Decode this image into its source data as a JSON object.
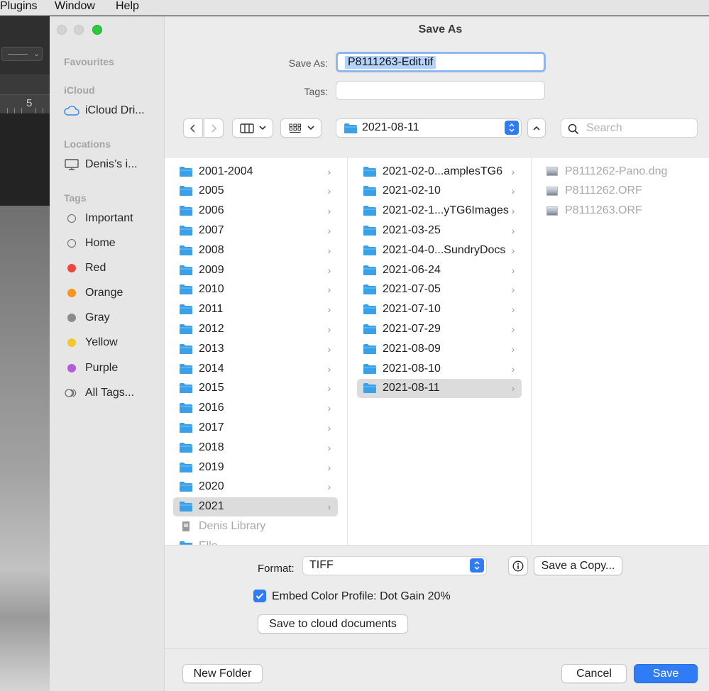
{
  "menubar": {
    "items": [
      "Plugins",
      "Window",
      "Help"
    ]
  },
  "background": {
    "ruler_number": "5"
  },
  "dialog": {
    "title": "Save As",
    "save_as_label": "Save As:",
    "filename": "P8111263-Edit.tif",
    "tags_label": "Tags:",
    "path_popup": "2021-08-11",
    "search_placeholder": "Search"
  },
  "sidebar": {
    "favourites_header": "Favourites",
    "icloud_header": "iCloud",
    "icloud_drive": "iCloud Dri...",
    "locations_header": "Locations",
    "computer": "Denis’s i...",
    "tags_header": "Tags",
    "tags": [
      {
        "label": "Important",
        "color": "none"
      },
      {
        "label": "Home",
        "color": "none"
      },
      {
        "label": "Red",
        "color": "#f0453a"
      },
      {
        "label": "Orange",
        "color": "#f6941e"
      },
      {
        "label": "Gray",
        "color": "#8c8c8c"
      },
      {
        "label": "Yellow",
        "color": "#f7c52c"
      },
      {
        "label": "Purple",
        "color": "#b25bdc"
      }
    ],
    "all_tags": "All Tags..."
  },
  "browser": {
    "col1": [
      "2001-2004",
      "2005",
      "2006",
      "2007",
      "2008",
      "2009",
      "2010",
      "2011",
      "2012",
      "2013",
      "2014",
      "2015",
      "2016",
      "2017",
      "2018",
      "2019",
      "2020",
      "2021"
    ],
    "col1_extra": [
      "Denis Library",
      "Elle..."
    ],
    "col1_selected": "2021",
    "col2": [
      "2021-02-0...amplesTG6",
      "2021-02-10",
      "2021-02-1...yTG6Images",
      "2021-03-25",
      "2021-04-0...SundryDocs",
      "2021-06-24",
      "2021-07-05",
      "2021-07-10",
      "2021-07-29",
      "2021-08-09",
      "2021-08-10",
      "2021-08-11"
    ],
    "col2_selected": "2021-08-11",
    "col3": [
      "P8111262-Pano.dng",
      "P8111262.ORF",
      "P8111263.ORF"
    ]
  },
  "options": {
    "format_label": "Format:",
    "format_value": "TIFF",
    "info_icon": "info-icon",
    "save_copy": "Save a Copy...",
    "embed_label": "Embed Color Profile:  Dot Gain 20%",
    "embed_checked": true,
    "cloud_button": "Save to cloud documents"
  },
  "footer": {
    "new_folder": "New Folder",
    "cancel": "Cancel",
    "save": "Save"
  },
  "colors": {
    "accent": "#2f7cf6",
    "folder": "#3aa0e8"
  }
}
